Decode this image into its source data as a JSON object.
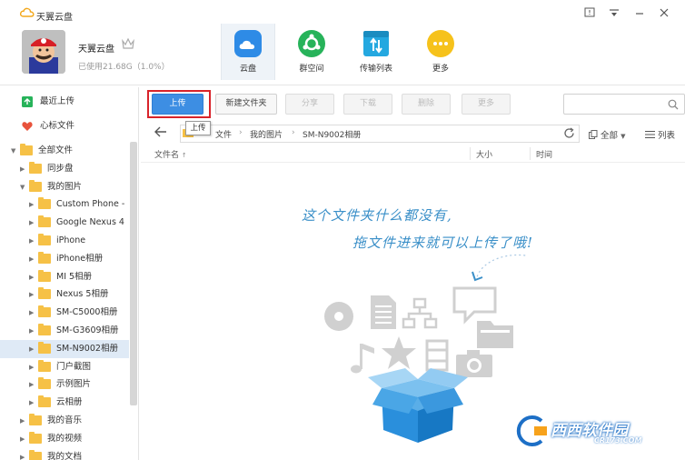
{
  "app": {
    "title": "天翼云盘"
  },
  "window_controls": [
    "minimize-to-tray",
    "menu",
    "minimize",
    "close"
  ],
  "user": {
    "name": "天翼云盘",
    "storage": "已使用21.68G（1.0%）"
  },
  "nav": [
    {
      "label": "云盘",
      "icon": "cloud-disk-icon",
      "color": "#2e8be6",
      "active": true
    },
    {
      "label": "群空间",
      "icon": "group-space-icon",
      "color": "#27b35a",
      "active": false
    },
    {
      "label": "传输列表",
      "icon": "transfer-list-icon",
      "color": "#24a8e0",
      "active": false
    },
    {
      "label": "更多",
      "icon": "more-icon",
      "color": "#f6c21b",
      "active": false
    }
  ],
  "sidebar": {
    "quick": [
      {
        "label": "最近上传",
        "icon": "recent-upload-icon"
      },
      {
        "label": "心标文件",
        "icon": "heart-icon"
      }
    ],
    "tree": [
      {
        "label": "全部文件",
        "indent": 0,
        "expanded": true
      },
      {
        "label": "同步盘",
        "indent": 1,
        "expanded": false
      },
      {
        "label": "我的图片",
        "indent": 1,
        "expanded": true
      },
      {
        "label": "Custom Phone -",
        "indent": 2,
        "expanded": false
      },
      {
        "label": "Google Nexus 4",
        "indent": 2,
        "expanded": false
      },
      {
        "label": "iPhone",
        "indent": 2,
        "expanded": false
      },
      {
        "label": "iPhone相册",
        "indent": 2,
        "expanded": false
      },
      {
        "label": "MI 5相册",
        "indent": 2,
        "expanded": false
      },
      {
        "label": "Nexus 5相册",
        "indent": 2,
        "expanded": false
      },
      {
        "label": "SM-C5000相册",
        "indent": 2,
        "expanded": false
      },
      {
        "label": "SM-G3609相册",
        "indent": 2,
        "expanded": false
      },
      {
        "label": "SM-N9002相册",
        "indent": 2,
        "expanded": false,
        "selected": true
      },
      {
        "label": "门户截图",
        "indent": 2,
        "expanded": false
      },
      {
        "label": "示例图片",
        "indent": 2,
        "expanded": false
      },
      {
        "label": "云相册",
        "indent": 2,
        "expanded": false
      },
      {
        "label": "我的音乐",
        "indent": 1,
        "expanded": false
      },
      {
        "label": "我的视频",
        "indent": 1,
        "expanded": false
      },
      {
        "label": "我的文档",
        "indent": 1,
        "expanded": false
      }
    ]
  },
  "toolbar": {
    "upload": "上传",
    "new_folder": "新建文件夹",
    "share": "分享",
    "download": "下载",
    "delete": "删除",
    "more": "更多",
    "tooltip": "上传",
    "highlight_color": "#d8232a"
  },
  "breadcrumb": [
    "文件",
    "我的图片",
    "SM-N9002相册"
  ],
  "view": {
    "filter": "全部",
    "mode": "列表"
  },
  "columns": {
    "name": "文件名",
    "size": "大小",
    "time": "时间"
  },
  "empty_state": {
    "line1": "这个文件夹什么都没有,",
    "line2": "拖文件进来就可以上传了哦!"
  },
  "watermark": {
    "text": "西西软件园",
    "sub": "CR173.COM"
  }
}
